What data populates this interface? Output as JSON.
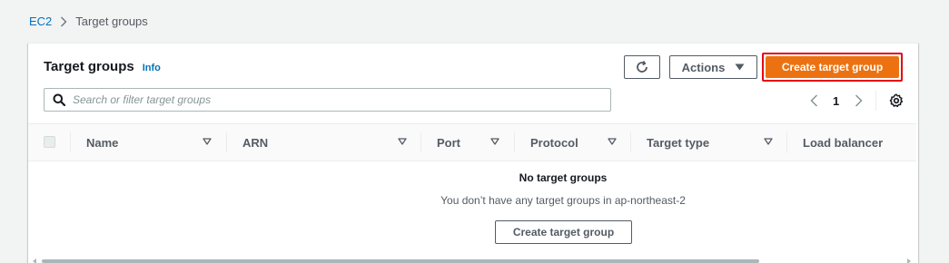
{
  "breadcrumb": {
    "root": "EC2",
    "current": "Target groups"
  },
  "panel": {
    "title": "Target groups",
    "info_link": "Info",
    "refresh_icon": "refresh-icon",
    "actions_label": "Actions",
    "create_label": "Create target group"
  },
  "search": {
    "placeholder": "Search or filter target groups",
    "value": ""
  },
  "pagination": {
    "current_page": "1"
  },
  "table": {
    "columns": [
      "Name",
      "ARN",
      "Port",
      "Protocol",
      "Target type",
      "Load balancer"
    ]
  },
  "empty_state": {
    "title": "No target groups",
    "description": "You don’t have any target groups in ap-northeast-2",
    "button_label": "Create target group"
  },
  "colors": {
    "primary": "#ec7211",
    "highlight_border": "#e30613",
    "link": "#0073bb"
  }
}
